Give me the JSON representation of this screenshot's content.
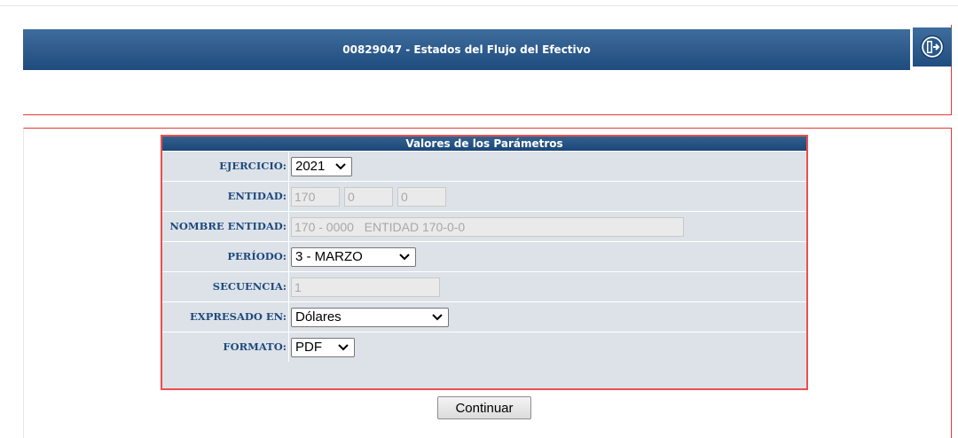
{
  "header": {
    "title": "00829047 - Estados del Flujo del Efectivo",
    "exit_icon": "exit-door-icon",
    "colors": {
      "bar": "#2b5a8c",
      "frame": "#e23a3a"
    }
  },
  "params": {
    "heading": "Valores de los Parámetros",
    "ejercicio": {
      "label": "EJERCICIO:",
      "value": "2021"
    },
    "entidad": {
      "label": "ENTIDAD:",
      "v1": "170",
      "v2": "0",
      "v3": "0"
    },
    "nombre_entidad": {
      "label": "NOMBRE ENTIDAD:",
      "value": "170 - 0000   ENTIDAD 170-0-0"
    },
    "periodo": {
      "label": "PERÍODO:",
      "value": "3 - MARZO"
    },
    "secuencia": {
      "label": "SECUENCIA:",
      "value": "1"
    },
    "expresado_en": {
      "label": "EXPRESADO EN:",
      "value": "Dólares"
    },
    "formato": {
      "label": "FORMATO:",
      "value": "PDF"
    }
  },
  "actions": {
    "continue_label": "Continuar"
  }
}
